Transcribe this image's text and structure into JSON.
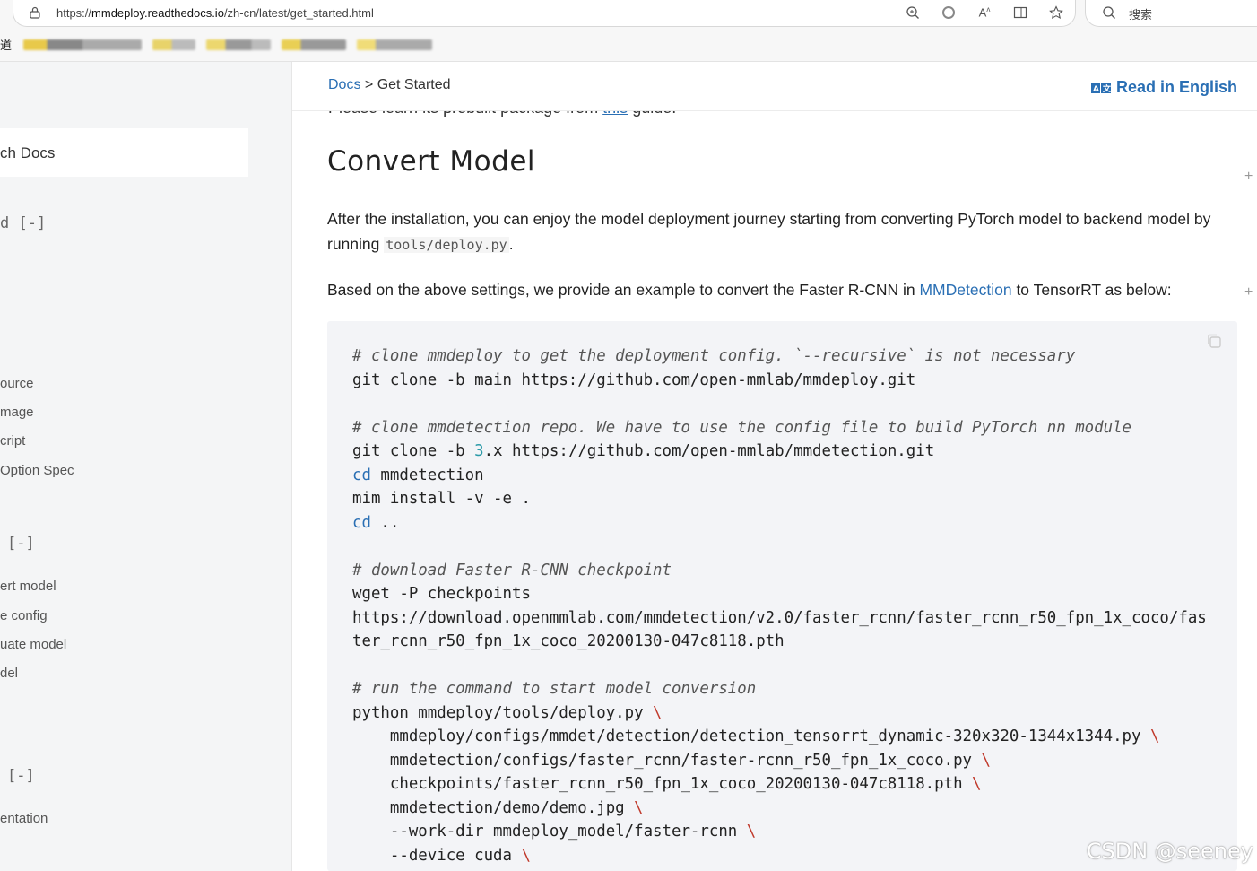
{
  "browser": {
    "url_prefix": "https://",
    "url_host": "mmdeploy.readthedocs.io",
    "url_path": "/zh-cn/latest/get_started.html",
    "search_placeholder": "搜索",
    "favorites_first_char": "道"
  },
  "sidebar": {
    "search_label": "ch Docs",
    "toggles": [
      "[-]",
      "[-]",
      "[-]"
    ],
    "toggle_prefix": "d",
    "section1_items": [
      "ource",
      "mage",
      "cript",
      "Option Spec"
    ],
    "section2_items": [
      "ert model",
      "e config",
      "uate model",
      "del"
    ],
    "section3_items": [
      "entation"
    ]
  },
  "header": {
    "breadcrumb_root": "Docs",
    "breadcrumb_sep": " > ",
    "breadcrumb_current": "Get Started",
    "read_english": "Read in English"
  },
  "content": {
    "partial_prefix": "Please learn its prebuilt package from ",
    "partial_link": "this",
    "partial_suffix": " guide.",
    "heading": "Convert Model",
    "p1_text": "After the installation, you can enjoy the model deployment journey starting from converting PyTorch model to backend model by running ",
    "p1_code": "tools/deploy.py",
    "p1_end": ".",
    "p2_text": "Based on the above settings, we provide an example to convert the Faster R-CNN in ",
    "p2_link": "MMDetection",
    "p2_end": " to TensorRT as below:"
  },
  "code": {
    "c1": "# clone mmdeploy to get the deployment config. `--recursive` is not necessary",
    "l1": "git clone -b main https://github.com/open-mmlab/mmdeploy.git",
    "c2": "# clone mmdetection repo. We have to use the config file to build PyTorch nn module",
    "l2a": "git clone -b ",
    "l2num": "3",
    "l2b": ".x https://github.com/open-mmlab/mmdetection.git",
    "l3kw": "cd",
    "l3": " mmdetection",
    "l4": "mim install -v -e .",
    "l5kw": "cd",
    "l5": " ..",
    "c3": "# download Faster R-CNN checkpoint",
    "l6": "wget -P checkpoints",
    "l7": "https://download.openmmlab.com/mmdetection/v2.0/faster_rcnn/faster_rcnn_r50_fpn_1x_coco/fas",
    "l8": "ter_rcnn_r50_fpn_1x_coco_20200130-047c8118.pth",
    "c4": "# run the command to start model conversion",
    "l9": "python mmdeploy/tools/deploy.py ",
    "l10": "    mmdeploy/configs/mmdet/detection/detection_tensorrt_dynamic-320x320-1344x1344.py ",
    "l11": "    mmdetection/configs/faster_rcnn/faster-rcnn_r50_fpn_1x_coco.py ",
    "l12": "    checkpoints/faster_rcnn_r50_fpn_1x_coco_20200130-047c8118.pth ",
    "l13": "    mmdetection/demo/demo.jpg ",
    "l14": "    --work-dir mmdeploy_model/faster-rcnn ",
    "l15": "    --device cuda ",
    "backslash": "\\"
  },
  "watermark": "CSDN @seeney"
}
